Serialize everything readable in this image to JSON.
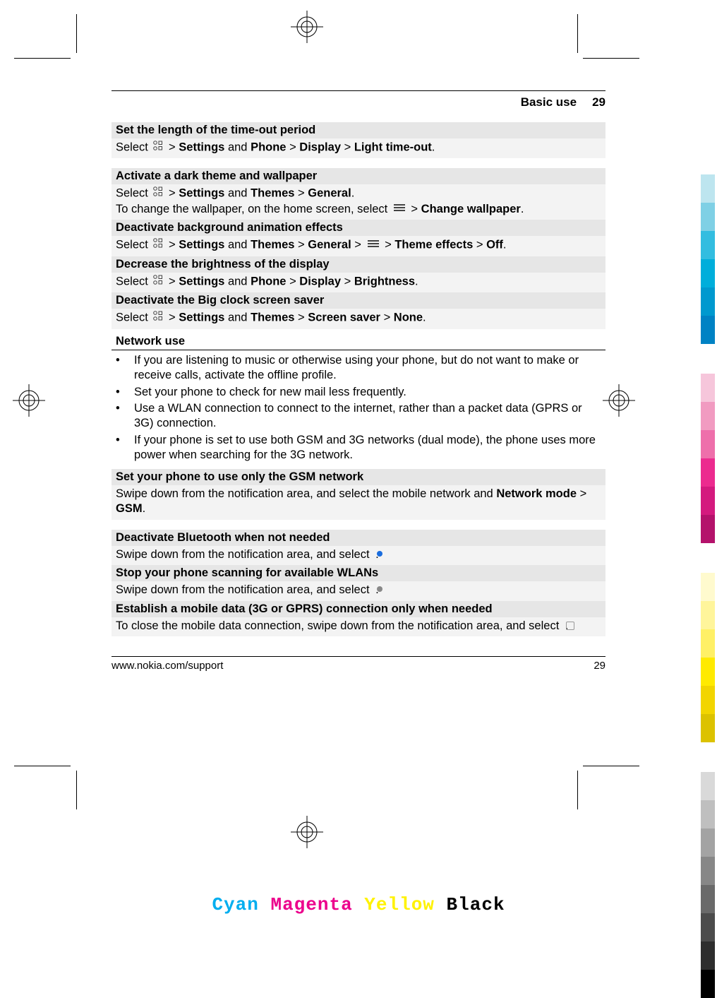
{
  "header": {
    "section": "Basic use",
    "page_top": "29"
  },
  "blocks": {
    "b1": {
      "title": "Set the length of the time-out period",
      "p1a": "Select ",
      "p1b": " > ",
      "settings": "Settings",
      "p1c": " and ",
      "phone": "Phone",
      "p1d": "  > ",
      "display": "Display",
      "p1e": "  > ",
      "lto": "Light time-out",
      "p1f": "."
    },
    "b2": {
      "title": "Activate a dark theme and wallpaper",
      "p1a": "Select ",
      "p1b": " > ",
      "settings": "Settings",
      "p1c": " and ",
      "themes": "Themes",
      "p1d": "  > ",
      "general": "General",
      "p1e": ".",
      "p2a": "To change the wallpaper, on the home screen, select ",
      "p2b": "  > ",
      "cw": "Change wallpaper",
      "p2c": "."
    },
    "b3": {
      "title": "Deactivate background animation effects",
      "p1a": "Select ",
      "p1b": " > ",
      "settings": "Settings",
      "p1c": " and ",
      "themes": "Themes",
      "p1d": "  > ",
      "general": "General",
      "p1e": "  > ",
      "p1f": "  > ",
      "te": "Theme effects",
      "p1g": "  > ",
      "off": "Off",
      "p1h": "."
    },
    "b4": {
      "title": "Decrease the brightness of the display",
      "p1a": "Select ",
      "p1b": " > ",
      "settings": "Settings",
      "p1c": " and ",
      "phone": "Phone",
      "p1d": "  > ",
      "display": "Display",
      "p1e": "  > ",
      "br": "Brightness",
      "p1f": "."
    },
    "b5": {
      "title": "Deactivate the Big clock screen saver",
      "p1a": "Select ",
      "p1b": " > ",
      "settings": "Settings",
      "p1c": " and ",
      "themes": "Themes",
      "p1d": "  > ",
      "ss": "Screen saver",
      "p1e": "  > ",
      "none": "None",
      "p1f": "."
    }
  },
  "network": {
    "title": "Network use",
    "items": [
      "If you are listening to music or otherwise using your phone, but do not want to make or receive calls, activate the offline profile.",
      "Set your phone to check for new mail less frequently.",
      "Use a WLAN connection to connect to the internet, rather than a packet data (GPRS or 3G) connection.",
      "If your phone is set to use both GSM and 3G networks (dual mode), the phone uses more power when searching for the 3G network."
    ]
  },
  "net_blocks": {
    "n1": {
      "title": "Set your phone to use only the GSM network",
      "p1a": "Swipe down from the notification area, and select the mobile network and ",
      "nm": "Network mode",
      "p1b": "  > ",
      "gsm": "GSM",
      "p1c": "."
    },
    "n2": {
      "title": "Deactivate Bluetooth when not needed",
      "p1a": "Swipe down from the notification area, and select ",
      "p1b": " ."
    },
    "n3": {
      "title": "Stop your phone scanning for available WLANs",
      "p1a": "Swipe down from the notification area, and select ",
      "p1b": "."
    },
    "n4": {
      "title": "Establish a mobile data (3G or GPRS) connection only when needed",
      "p1a": "To close the mobile data connection, swipe down from the notification area, and select ",
      "p1b": "."
    }
  },
  "footer": {
    "url": "www.nokia.com/support",
    "page_bottom": "29"
  },
  "cmyk": {
    "c": "Cyan",
    "m": "Magenta",
    "y": "Yellow",
    "k": "Black"
  },
  "colorbars": [
    "#bde5ef",
    "#7fd0e5",
    "#33bde0",
    "#00aedb",
    "#0099cf",
    "#0082c4",
    "#f6c6db",
    "#f19bc1",
    "#ee6fab",
    "#ec2b8f",
    "#d41a7e",
    "#b4126b",
    "#ffface",
    "#fff59b",
    "#fff066",
    "#ffea00",
    "#f2d500",
    "#dcc200",
    "#d9d9d9",
    "#bfbfbf",
    "#a3a3a3",
    "#878787",
    "#6a6a6a",
    "#4c4c4c",
    "#2e2e2e",
    "#000000"
  ]
}
